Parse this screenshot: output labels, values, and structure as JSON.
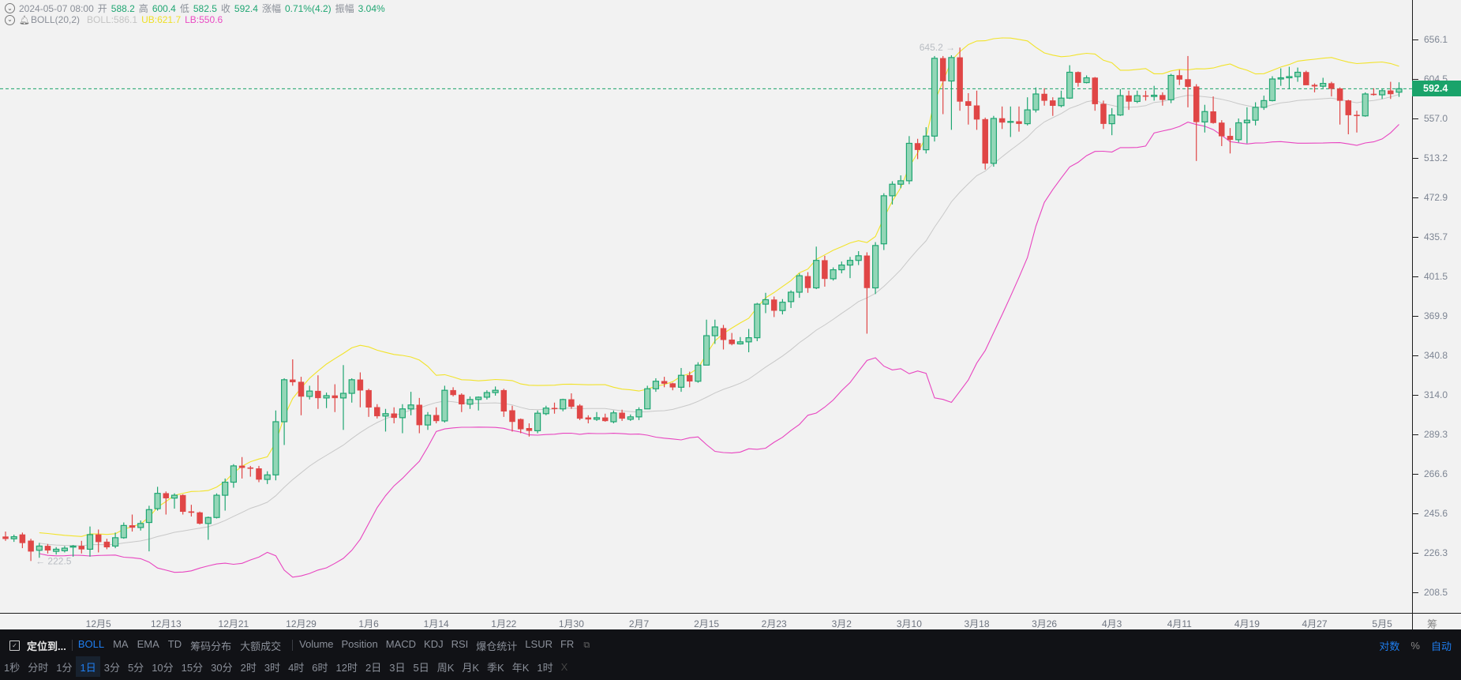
{
  "header": {
    "datetime": "2024-05-07 08:00",
    "open_label": "开",
    "open": "588.2",
    "high_label": "高",
    "high": "600.4",
    "low_label": "低",
    "low": "582.5",
    "close_label": "收",
    "close": "592.4",
    "change_label": "涨幅",
    "change": "0.71%(4.2)",
    "amplitude_label": "振幅",
    "amplitude": "3.04%",
    "indicator": "BOLL(20,2)",
    "boll": "BOLL:586.1",
    "ub": "UB:621.7",
    "lb": "LB:550.6"
  },
  "colors": {
    "up": "#1fa672",
    "up_fill": "#93d6b7",
    "down": "#e04646",
    "mid": "#c8c8c8",
    "ub": "#f2e32b",
    "lb": "#e845c0",
    "price_line": "#1aa36a"
  },
  "current_price": "592.4",
  "max_label": "645.2 →",
  "min_label": "← 222.5",
  "chart_data": {
    "type": "candlestick",
    "scale": "log",
    "ylim": [
      208.5,
      656.1
    ],
    "y_ticks": [
      "656.1",
      "604.5",
      "557.0",
      "513.2",
      "472.9",
      "435.7",
      "401.5",
      "369.9",
      "340.8",
      "314.0",
      "289.3",
      "266.6",
      "245.6",
      "226.3",
      "208.5"
    ],
    "x_labels": [
      {
        "label": "12月5",
        "index": 11
      },
      {
        "label": "12月13",
        "index": 19
      },
      {
        "label": "12月21",
        "index": 27
      },
      {
        "label": "12月29",
        "index": 35
      },
      {
        "label": "1月6",
        "index": 43
      },
      {
        "label": "1月14",
        "index": 51
      },
      {
        "label": "1月22",
        "index": 59
      },
      {
        "label": "1月30",
        "index": 67
      },
      {
        "label": "2月7",
        "index": 75
      },
      {
        "label": "2月15",
        "index": 83
      },
      {
        "label": "2月23",
        "index": 91
      },
      {
        "label": "3月2",
        "index": 99
      },
      {
        "label": "3月10",
        "index": 107
      },
      {
        "label": "3月18",
        "index": 115
      },
      {
        "label": "3月26",
        "index": 123
      },
      {
        "label": "4月3",
        "index": 131
      },
      {
        "label": "4月11",
        "index": 139
      },
      {
        "label": "4月19",
        "index": 147
      },
      {
        "label": "4月27",
        "index": 155
      },
      {
        "label": "5月5",
        "index": 163
      }
    ],
    "indicator": {
      "name": "BOLL",
      "period": 20,
      "k": 2
    },
    "ohlc": [
      [
        234,
        236.5,
        232,
        233
      ],
      [
        233,
        235,
        231.5,
        234
      ],
      [
        235,
        236,
        228.5,
        231
      ],
      [
        232,
        233,
        222.5,
        227
      ],
      [
        227.5,
        231,
        224,
        229.5
      ],
      [
        229.5,
        230.5,
        226,
        227.5
      ],
      [
        227,
        229,
        225.5,
        228
      ],
      [
        227.3,
        229.5,
        226.5,
        228.5
      ],
      [
        229,
        230,
        224.5,
        229.5
      ],
      [
        229.5,
        232,
        226,
        228
      ],
      [
        228,
        239,
        224.5,
        235
      ],
      [
        235,
        237.5,
        226.5,
        231.5
      ],
      [
        231.5,
        233,
        228,
        229
      ],
      [
        229.5,
        236,
        228.5,
        233.5
      ],
      [
        233.5,
        241,
        233,
        239.5
      ],
      [
        239.5,
        245,
        236.5,
        238.5
      ],
      [
        238.5,
        242,
        237,
        240.5
      ],
      [
        241,
        249.5,
        227,
        247.5
      ],
      [
        248,
        259.5,
        247,
        256
      ],
      [
        256,
        257,
        245,
        253.5
      ],
      [
        253.5,
        256,
        248,
        255
      ],
      [
        255,
        255.5,
        245,
        246.5
      ],
      [
        246.5,
        250,
        244,
        246
      ],
      [
        246,
        246.5,
        240,
        240.5
      ],
      [
        240.5,
        244,
        232.5,
        243.5
      ],
      [
        243.5,
        256,
        243,
        255
      ],
      [
        255,
        264,
        247,
        262
      ],
      [
        262,
        272,
        259,
        271
      ],
      [
        271,
        276,
        264,
        270
      ],
      [
        270,
        271,
        265,
        269.5
      ],
      [
        269.5,
        271,
        262,
        263.5
      ],
      [
        263.5,
        268,
        261,
        266
      ],
      [
        266,
        304,
        263,
        297
      ],
      [
        297,
        325,
        283,
        324
      ],
      [
        324,
        338,
        320,
        322.5
      ],
      [
        322.5,
        326,
        301,
        313
      ],
      [
        313,
        320,
        311,
        316.5
      ],
      [
        316.5,
        327,
        305,
        312
      ],
      [
        312,
        315.5,
        305.5,
        313.5
      ],
      [
        313.5,
        321,
        303,
        312
      ],
      [
        312,
        334,
        292,
        315
      ],
      [
        315,
        325,
        309,
        324
      ],
      [
        324,
        329,
        306,
        317
      ],
      [
        317,
        318,
        300,
        306
      ],
      [
        306,
        308,
        299,
        300.5
      ],
      [
        300.5,
        305,
        291,
        302
      ],
      [
        302,
        306,
        296,
        299.5
      ],
      [
        299.5,
        308,
        290,
        305
      ],
      [
        305,
        316,
        301,
        307.5
      ],
      [
        307.5,
        312,
        290,
        295
      ],
      [
        295,
        303,
        292,
        301
      ],
      [
        301,
        306,
        296,
        297.5
      ],
      [
        297.5,
        320,
        296.5,
        317
      ],
      [
        317,
        319,
        313,
        314
      ],
      [
        314,
        315,
        303,
        308
      ],
      [
        308,
        313,
        305,
        311
      ],
      [
        311,
        313,
        304,
        312.5
      ],
      [
        312.5,
        317,
        311,
        315.5
      ],
      [
        315.5,
        319.5,
        313.5,
        317
      ],
      [
        317,
        318,
        300,
        303.5
      ],
      [
        304,
        307,
        291,
        297
      ],
      [
        298.5,
        299,
        290,
        292.5
      ],
      [
        293,
        296,
        288,
        291.5
      ],
      [
        291.5,
        304,
        290,
        302.3
      ],
      [
        302,
        307,
        301,
        305.5
      ],
      [
        305.5,
        309,
        302,
        305
      ],
      [
        305,
        311.5,
        303.5,
        311
      ],
      [
        311,
        315,
        305,
        306.5
      ],
      [
        307,
        308,
        298,
        299
      ],
      [
        299.5,
        301,
        296,
        298.5
      ],
      [
        298.5,
        303,
        297.5,
        299.5
      ],
      [
        299.5,
        302,
        297,
        297.5
      ],
      [
        297,
        304,
        296,
        302.5
      ],
      [
        302.5,
        304.5,
        297.5,
        299
      ],
      [
        298.5,
        301.5,
        297.5,
        300
      ],
      [
        300,
        306,
        298,
        304.5
      ],
      [
        305,
        320,
        305,
        318
      ],
      [
        318,
        325,
        316,
        323
      ],
      [
        323,
        326,
        319,
        321.5
      ],
      [
        321.5,
        322,
        317,
        319
      ],
      [
        319,
        332,
        316,
        327
      ],
      [
        327,
        329.5,
        319,
        323
      ],
      [
        323,
        336,
        322,
        334
      ],
      [
        334,
        367,
        334,
        355
      ],
      [
        355,
        367,
        349,
        361.5
      ],
      [
        360.5,
        363,
        345,
        352
      ],
      [
        352,
        357,
        348,
        349
      ],
      [
        349,
        354,
        348.5,
        350.5
      ],
      [
        350.5,
        360,
        343,
        353.5
      ],
      [
        353.5,
        380,
        351,
        379
      ],
      [
        379,
        388,
        372,
        382.5
      ],
      [
        382.5,
        385,
        369,
        374
      ],
      [
        374,
        383,
        371,
        380.5
      ],
      [
        381,
        390,
        376,
        388.5
      ],
      [
        388.5,
        404,
        384,
        402
      ],
      [
        401.5,
        405,
        388,
        392
      ],
      [
        392,
        427,
        391,
        415
      ],
      [
        415,
        419,
        393,
        399.5
      ],
      [
        399.5,
        409,
        398,
        407
      ],
      [
        407,
        414,
        404,
        411
      ],
      [
        411,
        418,
        400,
        415
      ],
      [
        415,
        423,
        411,
        419
      ],
      [
        419,
        422,
        356.5,
        392
      ],
      [
        392,
        431,
        387,
        428
      ],
      [
        429.5,
        477,
        424,
        474.5
      ],
      [
        474.5,
        489,
        466,
        486
      ],
      [
        486,
        495,
        482,
        489.5
      ],
      [
        489.5,
        537,
        486,
        529
      ],
      [
        529,
        534,
        512,
        522
      ],
      [
        522,
        547,
        518,
        537
      ],
      [
        537,
        634,
        531,
        631
      ],
      [
        631,
        634,
        562,
        602
      ],
      [
        602,
        635,
        544,
        632
      ],
      [
        632,
        645.2,
        566,
        577
      ],
      [
        577,
        587,
        550,
        572
      ],
      [
        572,
        590,
        544,
        556
      ],
      [
        556,
        558,
        501,
        507.5
      ],
      [
        507.5,
        560,
        504,
        557
      ],
      [
        557,
        571,
        545,
        552.5
      ],
      [
        553,
        571,
        536,
        553.5
      ],
      [
        553.5,
        571,
        542,
        551
      ],
      [
        551,
        582,
        549,
        567
      ],
      [
        567,
        594,
        564,
        586
      ],
      [
        586,
        593,
        572,
        578
      ],
      [
        578,
        582,
        560,
        572
      ],
      [
        572,
        590,
        570,
        581
      ],
      [
        581,
        622,
        580,
        613
      ],
      [
        613,
        614,
        595,
        600
      ],
      [
        600,
        609,
        599,
        606
      ],
      [
        606,
        607,
        566,
        574
      ],
      [
        574,
        578,
        545,
        551
      ],
      [
        551,
        569,
        538,
        561
      ],
      [
        561,
        592,
        560,
        584
      ],
      [
        584,
        590,
        567,
        577
      ],
      [
        577,
        590,
        575,
        584
      ],
      [
        584,
        590,
        578,
        583
      ],
      [
        583,
        596,
        578,
        584.5
      ],
      [
        584.5,
        588,
        572,
        579
      ],
      [
        579,
        611,
        575,
        609
      ],
      [
        609,
        616,
        597,
        604
      ],
      [
        604,
        634,
        570,
        595
      ],
      [
        595,
        598,
        510,
        553
      ],
      [
        553,
        573,
        541,
        565
      ],
      [
        565,
        583,
        551,
        552
      ],
      [
        552,
        555,
        526,
        537
      ],
      [
        537,
        546,
        518,
        533
      ],
      [
        533,
        557,
        530,
        552
      ],
      [
        552,
        570,
        529,
        555
      ],
      [
        555,
        576,
        549,
        570
      ],
      [
        570,
        584,
        567,
        578
      ],
      [
        578,
        608,
        577,
        604.5
      ],
      [
        604.5,
        618,
        596,
        606
      ],
      [
        606,
        620,
        592,
        607.5
      ],
      [
        607.5,
        619,
        601,
        613
      ],
      [
        613,
        615,
        597,
        597
      ],
      [
        597,
        599,
        588,
        595.5
      ],
      [
        595.5,
        606,
        593,
        599
      ],
      [
        599,
        601,
        583,
        592.5
      ],
      [
        592.5,
        594,
        550,
        578
      ],
      [
        578,
        579,
        539,
        561
      ],
      [
        561,
        566,
        541,
        560
      ],
      [
        560,
        588,
        559,
        586
      ],
      [
        586,
        593,
        584,
        585
      ],
      [
        585,
        592,
        580,
        590
      ],
      [
        590,
        601,
        580,
        586
      ],
      [
        588.2,
        600.4,
        582.5,
        592.4
      ]
    ]
  },
  "xaxis_right": "筹 爆",
  "toolbar": {
    "locate": "定位到...",
    "main_indicators": [
      "BOLL",
      "MA",
      "EMA",
      "TD",
      "筹码分布",
      "大额成交"
    ],
    "sub_indicators": [
      "Volume",
      "Position",
      "MACD",
      "KDJ",
      "RSI",
      "爆仓统计",
      "LSUR",
      "FR"
    ],
    "right": [
      "对数",
      "%",
      "自动"
    ],
    "periods": [
      "1秒",
      "分时",
      "1分",
      "1日",
      "3分",
      "5分",
      "10分",
      "15分",
      "30分",
      "2时",
      "3时",
      "4时",
      "6时",
      "12时",
      "2日",
      "3日",
      "5日",
      "周K",
      "月K",
      "季K",
      "年K",
      "1时"
    ],
    "active_period": "1日",
    "close": "X"
  }
}
